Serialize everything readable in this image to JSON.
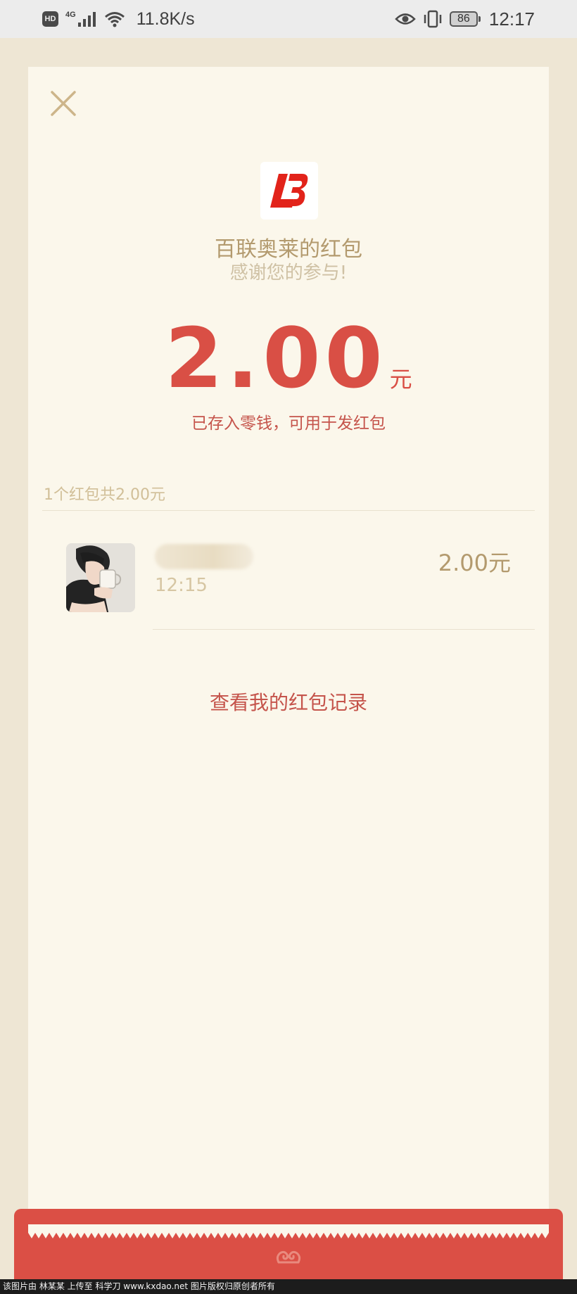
{
  "status_bar": {
    "hd_label": "HD",
    "network_label": "4G",
    "speed": "11.8K/s",
    "battery": "86",
    "time": "12:17"
  },
  "card": {
    "sender_name": "百联奥莱的红包",
    "thanks": "感谢您的参与!",
    "amount": "2.00",
    "currency": "元",
    "stored_note": "已存入零钱，可用于发红包",
    "summary": "1个红包共2.00元",
    "record": {
      "time": "12:15",
      "amount": "2.00元"
    },
    "view_records": "查看我的红包记录"
  },
  "footer": {
    "text": "该图片由 林某某 上传至 科学刀 www.kxdao.net 图片版权归原创者所有"
  },
  "colors": {
    "accent_red": "#D94F45",
    "gold": "#B39A6E",
    "card_bg": "#FBF7EB",
    "page_bg": "#EEE6D4"
  }
}
